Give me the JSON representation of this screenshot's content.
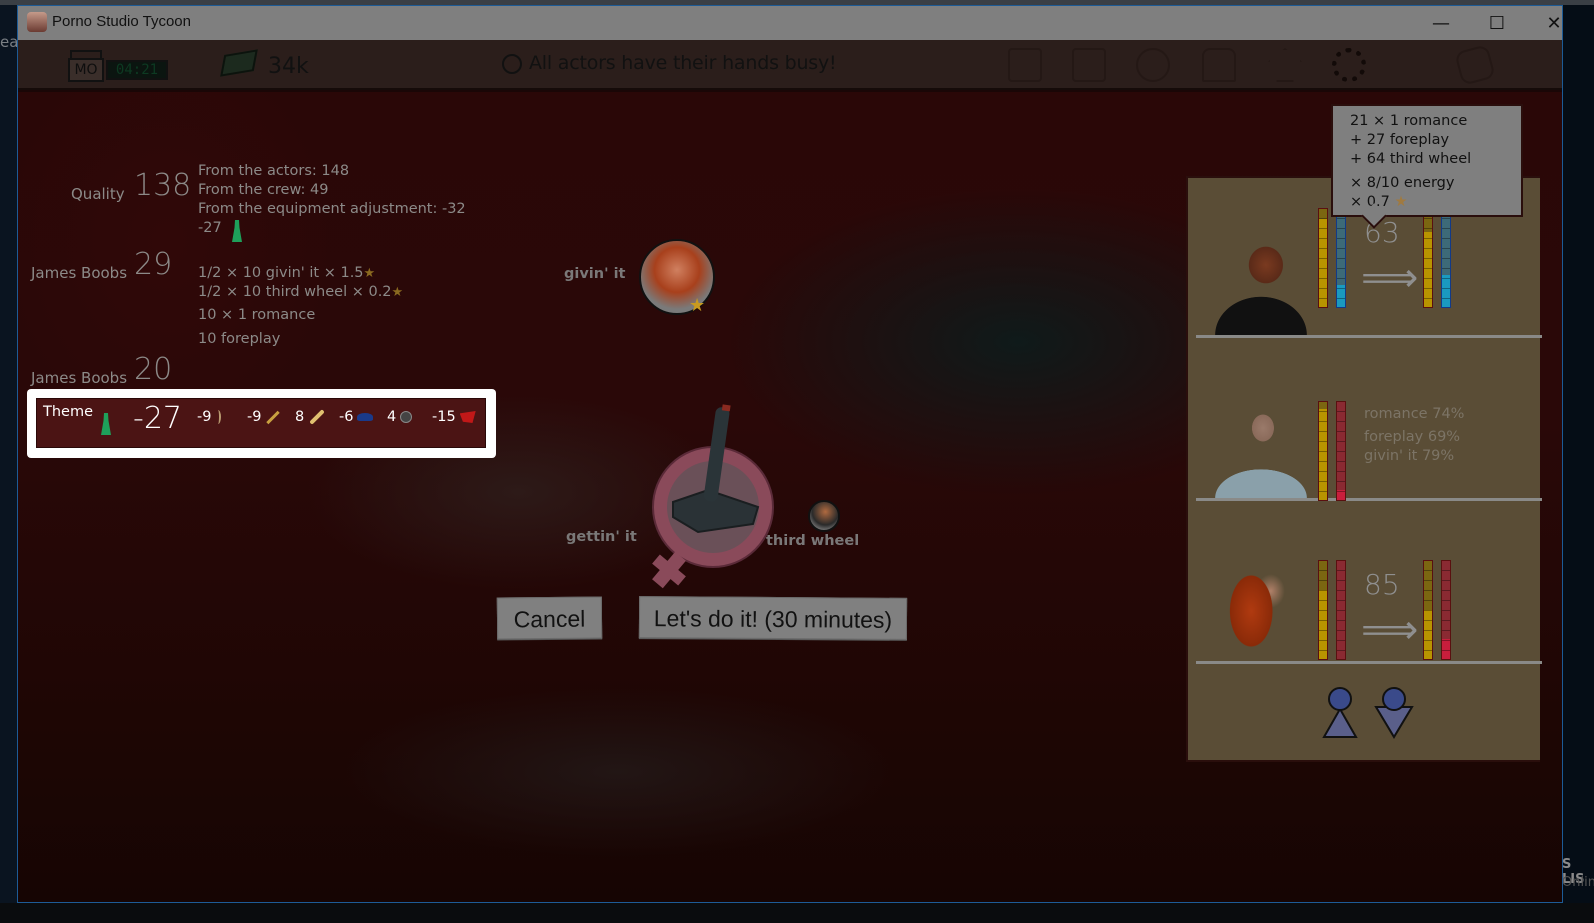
{
  "desktop": {
    "left_snippet": "ea",
    "right_snippet_1": "S LIS",
    "right_snippet_2": "Onlin"
  },
  "window": {
    "title": "Porno Studio Tycoon",
    "minimize": "—",
    "maximize": "☐",
    "close": "✕"
  },
  "topbar": {
    "day": "MO",
    "time": "04:21",
    "money": "34k",
    "status": "All actors have their hands busy!",
    "icons": [
      "map-icon",
      "calculator-icon",
      "globe-www-icon",
      "tshirt-icon",
      "upgrade-arrow-icon",
      "gear-icon",
      "bag-icon"
    ]
  },
  "quality": {
    "label": "Quality",
    "value": "138",
    "breakdown": [
      "From the actors: 148",
      "From the crew: 49",
      "From the equipment adjustment: -32",
      "-27"
    ]
  },
  "actors": [
    {
      "name": "James Boobs",
      "value": "29",
      "lines": [
        "1/2 × 10 givin' it × 1.5",
        "1/2 × 10 third wheel × 0.2",
        "10 × 1 romance",
        "10 foreplay"
      ]
    },
    {
      "name": "James Boobs",
      "value": "20"
    }
  ],
  "theme": {
    "label": "Theme",
    "value": "-27",
    "modifiers": [
      {
        "value": "-9",
        "icon": "boomerang-icon"
      },
      {
        "value": "-9",
        "icon": "spear-icon"
      },
      {
        "value": "8",
        "icon": "rolling-pin-icon"
      },
      {
        "value": "-6",
        "icon": "graduation-cap-icon"
      },
      {
        "value": "4",
        "icon": "frying-pan-icon"
      },
      {
        "value": "-15",
        "icon": "cape-icon"
      }
    ]
  },
  "scene": {
    "roles": {
      "giving": "givin' it",
      "getting": "gettin' it",
      "third": "third wheel"
    },
    "star": "★"
  },
  "buttons": {
    "cancel": "Cancel",
    "confirm": "Let's do it! (30 minutes)"
  },
  "tooltip": {
    "lines": [
      "21 × 1 romance",
      "+ 27 foreplay",
      "+ 64 third wheel"
    ],
    "mults": [
      "× 8/10 energy",
      "× 0.7"
    ],
    "star": "★"
  },
  "cast": [
    {
      "role": "male-actor",
      "score": "63",
      "bars_before": {
        "yellow": 0.9,
        "blue": 0.22
      },
      "bars_after": {
        "yellow": 0.77,
        "blue": 0.33
      }
    },
    {
      "role": "female-actor-silver",
      "skills": [
        "romance 74%",
        "foreplay 69%",
        "givin' it 79%"
      ],
      "bars": {
        "yellow": 0.93,
        "red": 0.1
      }
    },
    {
      "role": "female-actor-red",
      "score": "85",
      "bars_before": {
        "yellow": 0.7,
        "red": 0.0
      },
      "bars_after": {
        "yellow": 0.5,
        "red": 0.2
      }
    }
  ],
  "add_slot": {
    "icons": [
      "male-figure-icon",
      "female-figure-icon"
    ]
  },
  "arrow": "⟹"
}
